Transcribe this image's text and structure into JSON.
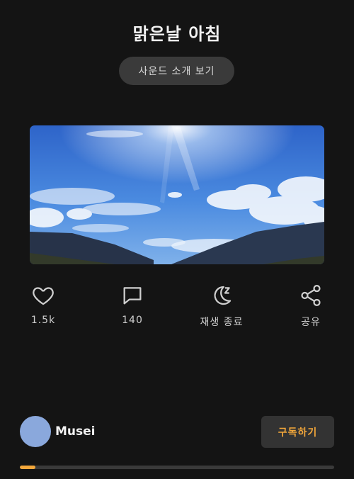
{
  "header": {
    "title": "맑은날 아침",
    "sound_intro_label": "사운드 소개 보기"
  },
  "actions": [
    {
      "icon": "heart-icon",
      "label": "1.5k"
    },
    {
      "icon": "comment-icon",
      "label": "140"
    },
    {
      "icon": "sleep-timer-icon",
      "label": "재생 종료"
    },
    {
      "icon": "share-icon",
      "label": "공유"
    }
  ],
  "profile": {
    "name": "Musei",
    "avatar_color": "#8aa8dc"
  },
  "subscribe_label": "구독하기",
  "playback": {
    "progress": 0.05
  },
  "colors": {
    "background": "#141414",
    "accent": "#f3a73b"
  }
}
